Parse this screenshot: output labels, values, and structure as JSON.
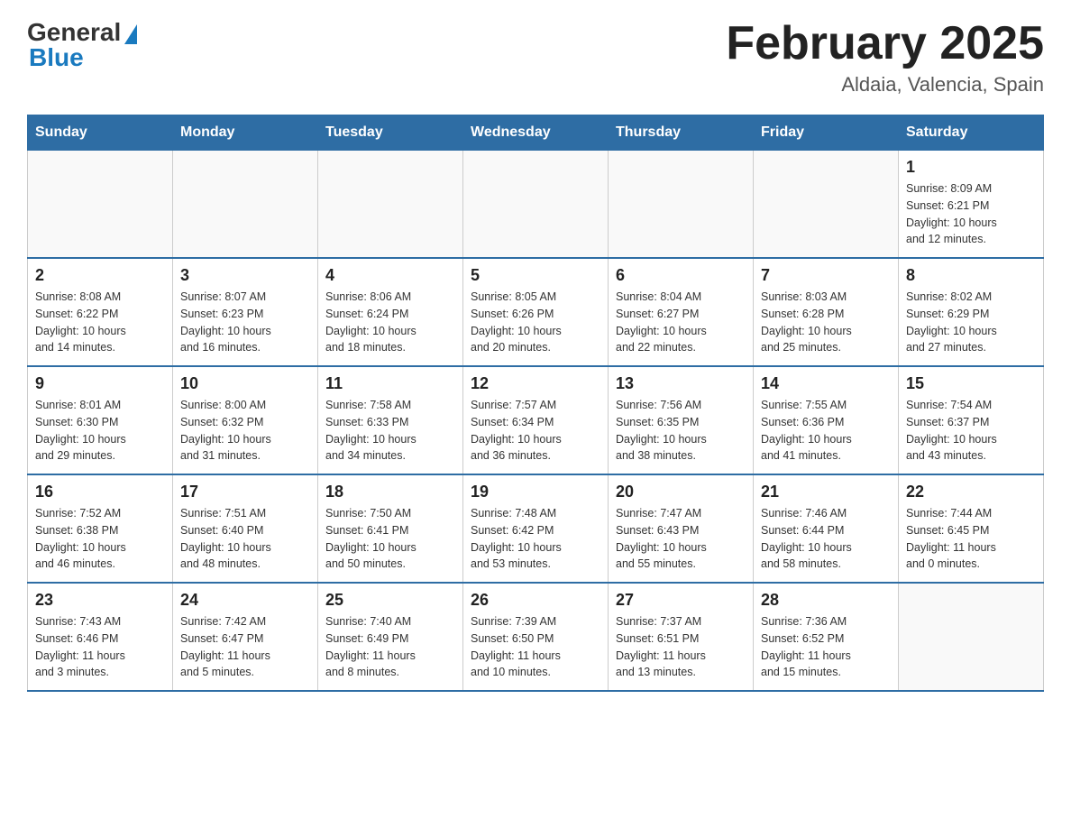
{
  "header": {
    "logo_general": "General",
    "logo_blue": "Blue",
    "title": "February 2025",
    "subtitle": "Aldaia, Valencia, Spain"
  },
  "weekdays": [
    "Sunday",
    "Monday",
    "Tuesday",
    "Wednesday",
    "Thursday",
    "Friday",
    "Saturday"
  ],
  "weeks": [
    [
      {
        "day": "",
        "info": ""
      },
      {
        "day": "",
        "info": ""
      },
      {
        "day": "",
        "info": ""
      },
      {
        "day": "",
        "info": ""
      },
      {
        "day": "",
        "info": ""
      },
      {
        "day": "",
        "info": ""
      },
      {
        "day": "1",
        "info": "Sunrise: 8:09 AM\nSunset: 6:21 PM\nDaylight: 10 hours\nand 12 minutes."
      }
    ],
    [
      {
        "day": "2",
        "info": "Sunrise: 8:08 AM\nSunset: 6:22 PM\nDaylight: 10 hours\nand 14 minutes."
      },
      {
        "day": "3",
        "info": "Sunrise: 8:07 AM\nSunset: 6:23 PM\nDaylight: 10 hours\nand 16 minutes."
      },
      {
        "day": "4",
        "info": "Sunrise: 8:06 AM\nSunset: 6:24 PM\nDaylight: 10 hours\nand 18 minutes."
      },
      {
        "day": "5",
        "info": "Sunrise: 8:05 AM\nSunset: 6:26 PM\nDaylight: 10 hours\nand 20 minutes."
      },
      {
        "day": "6",
        "info": "Sunrise: 8:04 AM\nSunset: 6:27 PM\nDaylight: 10 hours\nand 22 minutes."
      },
      {
        "day": "7",
        "info": "Sunrise: 8:03 AM\nSunset: 6:28 PM\nDaylight: 10 hours\nand 25 minutes."
      },
      {
        "day": "8",
        "info": "Sunrise: 8:02 AM\nSunset: 6:29 PM\nDaylight: 10 hours\nand 27 minutes."
      }
    ],
    [
      {
        "day": "9",
        "info": "Sunrise: 8:01 AM\nSunset: 6:30 PM\nDaylight: 10 hours\nand 29 minutes."
      },
      {
        "day": "10",
        "info": "Sunrise: 8:00 AM\nSunset: 6:32 PM\nDaylight: 10 hours\nand 31 minutes."
      },
      {
        "day": "11",
        "info": "Sunrise: 7:58 AM\nSunset: 6:33 PM\nDaylight: 10 hours\nand 34 minutes."
      },
      {
        "day": "12",
        "info": "Sunrise: 7:57 AM\nSunset: 6:34 PM\nDaylight: 10 hours\nand 36 minutes."
      },
      {
        "day": "13",
        "info": "Sunrise: 7:56 AM\nSunset: 6:35 PM\nDaylight: 10 hours\nand 38 minutes."
      },
      {
        "day": "14",
        "info": "Sunrise: 7:55 AM\nSunset: 6:36 PM\nDaylight: 10 hours\nand 41 minutes."
      },
      {
        "day": "15",
        "info": "Sunrise: 7:54 AM\nSunset: 6:37 PM\nDaylight: 10 hours\nand 43 minutes."
      }
    ],
    [
      {
        "day": "16",
        "info": "Sunrise: 7:52 AM\nSunset: 6:38 PM\nDaylight: 10 hours\nand 46 minutes."
      },
      {
        "day": "17",
        "info": "Sunrise: 7:51 AM\nSunset: 6:40 PM\nDaylight: 10 hours\nand 48 minutes."
      },
      {
        "day": "18",
        "info": "Sunrise: 7:50 AM\nSunset: 6:41 PM\nDaylight: 10 hours\nand 50 minutes."
      },
      {
        "day": "19",
        "info": "Sunrise: 7:48 AM\nSunset: 6:42 PM\nDaylight: 10 hours\nand 53 minutes."
      },
      {
        "day": "20",
        "info": "Sunrise: 7:47 AM\nSunset: 6:43 PM\nDaylight: 10 hours\nand 55 minutes."
      },
      {
        "day": "21",
        "info": "Sunrise: 7:46 AM\nSunset: 6:44 PM\nDaylight: 10 hours\nand 58 minutes."
      },
      {
        "day": "22",
        "info": "Sunrise: 7:44 AM\nSunset: 6:45 PM\nDaylight: 11 hours\nand 0 minutes."
      }
    ],
    [
      {
        "day": "23",
        "info": "Sunrise: 7:43 AM\nSunset: 6:46 PM\nDaylight: 11 hours\nand 3 minutes."
      },
      {
        "day": "24",
        "info": "Sunrise: 7:42 AM\nSunset: 6:47 PM\nDaylight: 11 hours\nand 5 minutes."
      },
      {
        "day": "25",
        "info": "Sunrise: 7:40 AM\nSunset: 6:49 PM\nDaylight: 11 hours\nand 8 minutes."
      },
      {
        "day": "26",
        "info": "Sunrise: 7:39 AM\nSunset: 6:50 PM\nDaylight: 11 hours\nand 10 minutes."
      },
      {
        "day": "27",
        "info": "Sunrise: 7:37 AM\nSunset: 6:51 PM\nDaylight: 11 hours\nand 13 minutes."
      },
      {
        "day": "28",
        "info": "Sunrise: 7:36 AM\nSunset: 6:52 PM\nDaylight: 11 hours\nand 15 minutes."
      },
      {
        "day": "",
        "info": ""
      }
    ]
  ]
}
